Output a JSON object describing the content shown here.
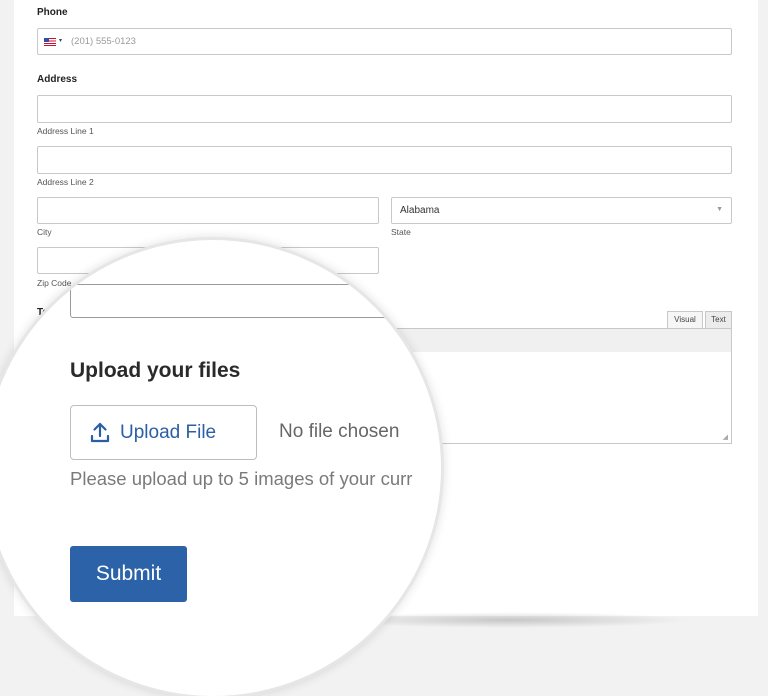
{
  "form": {
    "phone": {
      "label": "Phone",
      "country_caret": "▾",
      "placeholder": "(201) 555-0123"
    },
    "address": {
      "label": "Address",
      "line1_sublabel": "Address Line 1",
      "line2_sublabel": "Address Line 2",
      "city_sublabel": "City",
      "state_sublabel": "State",
      "state_value": "Alabama",
      "zip_sublabel": "Zip Code"
    },
    "textarea": {
      "label_partial": "Te",
      "tab_visual": "Visual",
      "tab_text": "Text"
    }
  },
  "magnifier": {
    "upload_title": "Upload your files",
    "upload_button_label": "Upload File",
    "no_file_text": "No file chosen",
    "help_text": "Please upload up to 5 images of your curr",
    "submit_label": "Submit"
  },
  "icons": {
    "flag": "us-flag-icon",
    "upload": "upload-arrow-icon",
    "select_caret": "chevron-down-icon"
  },
  "colors": {
    "accent_blue": "#2b62a8",
    "link_blue": "#2b5ea6",
    "border_gray": "#c8c8c8"
  }
}
